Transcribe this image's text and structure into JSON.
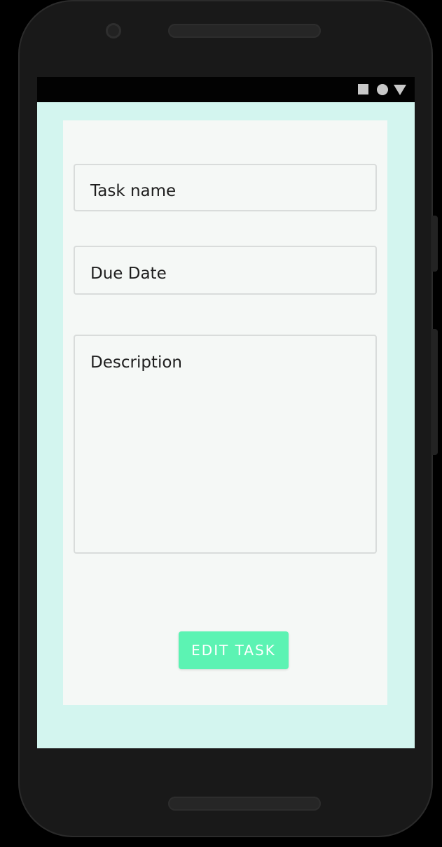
{
  "status_bar": {
    "icons": [
      "stop-square-icon",
      "record-circle-icon",
      "signal-triangle-icon"
    ]
  },
  "form": {
    "task_name_placeholder": "Task name",
    "due_date_placeholder": "Due Date",
    "description_placeholder": "Description",
    "submit_label": "EDIT TASK"
  },
  "colors": {
    "background": "#d3f5ef",
    "card": "#f5f8f6",
    "accent": "#5cf3b3"
  }
}
